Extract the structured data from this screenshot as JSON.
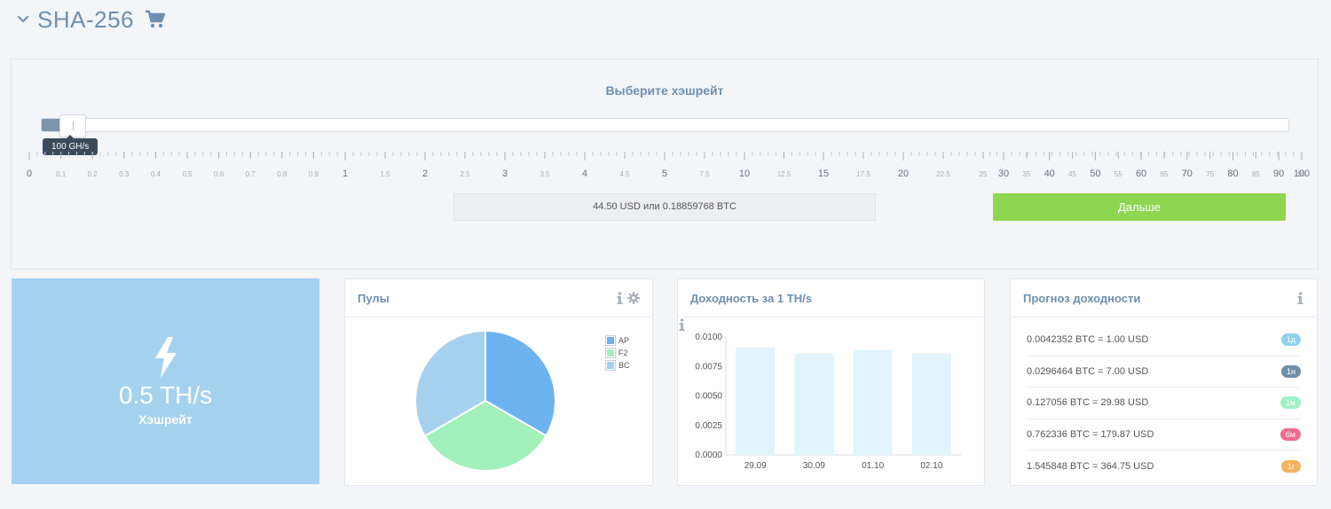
{
  "header": {
    "title": "SHA-256",
    "icons": [
      "chevron-down-icon",
      "cart-icon"
    ]
  },
  "slider": {
    "label": "Выберите хэшрейт",
    "tooltip": "100 GH/s",
    "scale_labels": [
      "0",
      "0.1",
      "0.2",
      "0.3",
      "0.4",
      "0.5",
      "0.6",
      "0.7",
      "0.8",
      "0.9",
      "1",
      "1.5",
      "2",
      "2.5",
      "3",
      "3.5",
      "4",
      "4.5",
      "5",
      "7.5",
      "10",
      "12.5",
      "15",
      "17.5",
      "20",
      "22.5",
      "25",
      "30",
      "35",
      "40",
      "45",
      "50",
      "55",
      "60",
      "65",
      "70",
      "75",
      "80",
      "85",
      "90",
      "95",
      "100"
    ],
    "major_labels": [
      "0",
      "1",
      "2",
      "3",
      "4",
      "5",
      "10",
      "15",
      "20",
      "30",
      "40",
      "50",
      "60",
      "70",
      "80",
      "90",
      "100"
    ],
    "price_text": "44.50 USD или 0.18859768 BTC",
    "next_button": "Дальше",
    "colors": {
      "fill": "#7d95ad",
      "button": "#8ed651"
    }
  },
  "hashrate_tile": {
    "value": "0.5 TH/s",
    "label": "Хэшрейт",
    "icon": "lightning-icon",
    "color": "#a4d2ee"
  },
  "pools_card": {
    "title": "Пулы",
    "chart_data": {
      "type": "pie",
      "labels": [
        "AP",
        "F2",
        "BC"
      ],
      "values": [
        33.3,
        33.3,
        33.4
      ],
      "colors": [
        "#6bb4f0",
        "#a1f0b9",
        "#a6d1ee"
      ],
      "legend_position": "top-right"
    }
  },
  "yield_card": {
    "title": "Доходность за 1 TH/s",
    "chart_data": {
      "type": "bar",
      "categories": [
        "29.09",
        "30.09",
        "01.10",
        "02.10"
      ],
      "values": [
        0.0091,
        0.0086,
        0.0089,
        0.0086
      ],
      "yticks": [
        "0.0000",
        "0.0025",
        "0.0050",
        "0.0075",
        "0.0100"
      ],
      "ylim": [
        0,
        0.01
      ],
      "color": "#e1f3fc"
    }
  },
  "forecast_card": {
    "title": "Прогноз доходности",
    "rows": [
      {
        "text": "0.0042352 BTC = 1.00 USD",
        "badge": "1д",
        "color": "#8fd0ec"
      },
      {
        "text": "0.0296464 BTC = 7.00 USD",
        "badge": "1н",
        "color": "#6f8fa8"
      },
      {
        "text": "0.127056 BTC = 29.98 USD",
        "badge": "1м",
        "color": "#9ef0c4"
      },
      {
        "text": "0.762336 BTC = 179.87 USD",
        "badge": "6м",
        "color": "#ee6c8e"
      },
      {
        "text": "1.545848 BTC = 364.75 USD",
        "badge": "1г",
        "color": "#f4b45d"
      }
    ]
  }
}
